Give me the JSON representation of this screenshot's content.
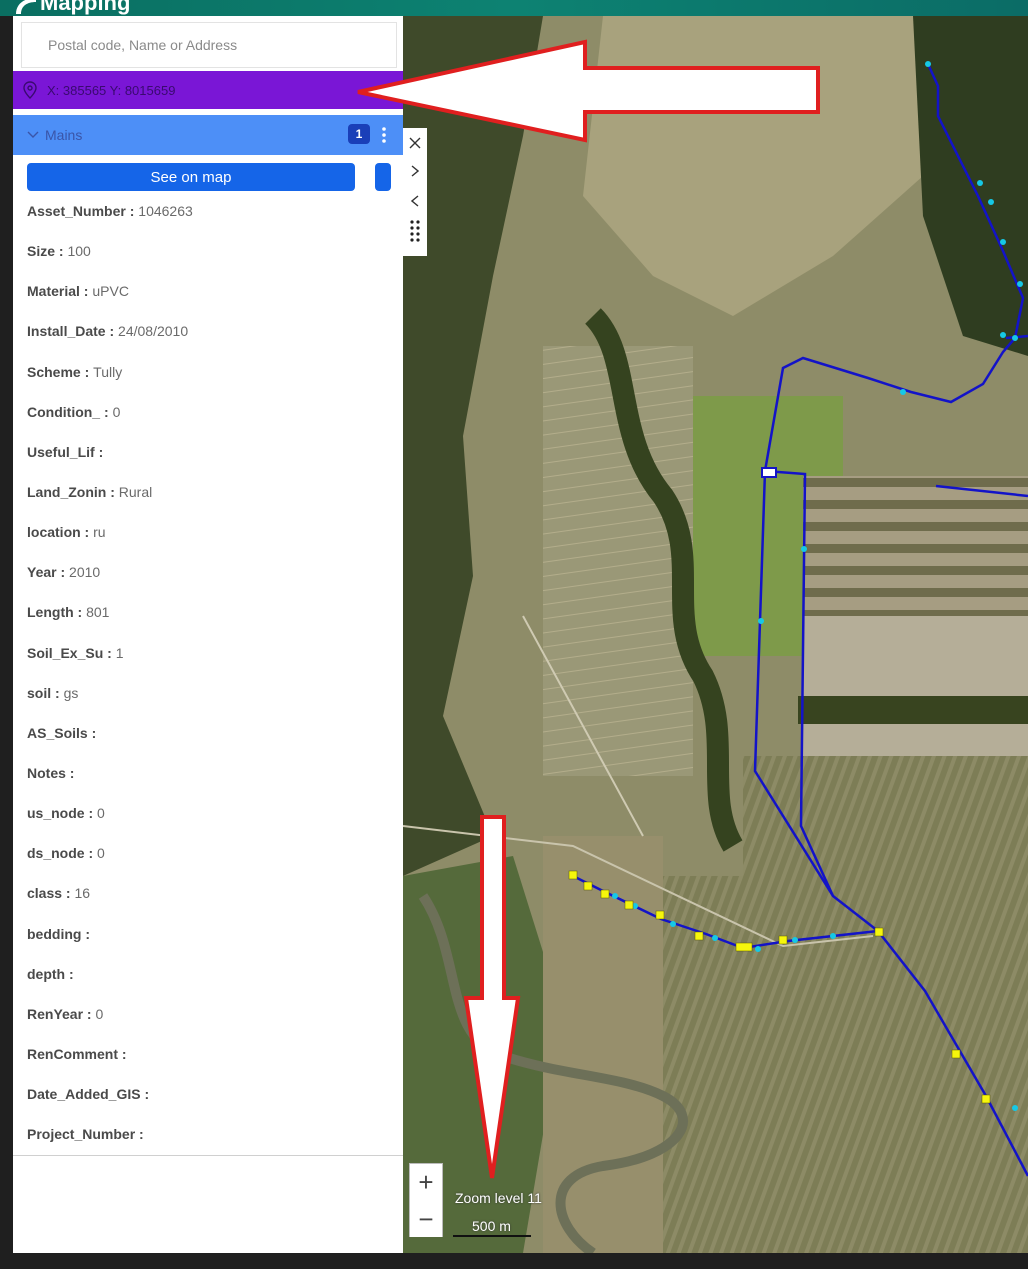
{
  "header": {
    "title": "Mapping"
  },
  "search": {
    "placeholder": "Postal code, Name or Address",
    "value": ""
  },
  "location": {
    "coordinates": "X: 385565  Y: 8015659"
  },
  "layer_section": {
    "label": "Mains",
    "count": "1"
  },
  "actions": {
    "see_on_map": "See on map"
  },
  "attributes": [
    {
      "key": "Asset_Number",
      "value": "1046263"
    },
    {
      "key": "Size",
      "value": "100"
    },
    {
      "key": "Material",
      "value": "uPVC"
    },
    {
      "key": "Install_Date",
      "value": "24/08/2010"
    },
    {
      "key": "Scheme",
      "value": "Tully"
    },
    {
      "key": "Condition_",
      "value": "0"
    },
    {
      "key": "Useful_Lif",
      "value": ""
    },
    {
      "key": "Land_Zonin",
      "value": "Rural"
    },
    {
      "key": "location",
      "value": "ru"
    },
    {
      "key": "Year",
      "value": "2010"
    },
    {
      "key": "Length",
      "value": "801"
    },
    {
      "key": "Soil_Ex_Su",
      "value": "1"
    },
    {
      "key": "soil",
      "value": "gs"
    },
    {
      "key": "AS_Soils",
      "value": ""
    },
    {
      "key": "Notes",
      "value": ""
    },
    {
      "key": "us_node",
      "value": "0"
    },
    {
      "key": "ds_node",
      "value": "0"
    },
    {
      "key": "class",
      "value": "16"
    },
    {
      "key": "bedding",
      "value": ""
    },
    {
      "key": "depth",
      "value": ""
    },
    {
      "key": "RenYear",
      "value": "0"
    },
    {
      "key": "RenComment",
      "value": ""
    },
    {
      "key": "Date_Added_GIS",
      "value": ""
    },
    {
      "key": "Project_Number",
      "value": ""
    }
  ],
  "separator": " : ",
  "map": {
    "zoom_label": "Zoom level 11",
    "scale_label": "500 m",
    "zoom_in": "+",
    "zoom_out": "−",
    "pipe_color": "#1313c8",
    "node_color": "#16c8e6",
    "valve_color": "#f6f60c"
  },
  "toolbar_icons": [
    "close-icon",
    "chevron-right-icon",
    "chevron-left-icon",
    "drag-handle-icon"
  ],
  "annotation": {
    "arrow_color": "#e01f1f"
  },
  "colors": {
    "header": "#0b7a6c",
    "coordinates_bar": "#7a16d6",
    "section_bar": "#4d8ff7",
    "primary_button": "#1565e8"
  }
}
